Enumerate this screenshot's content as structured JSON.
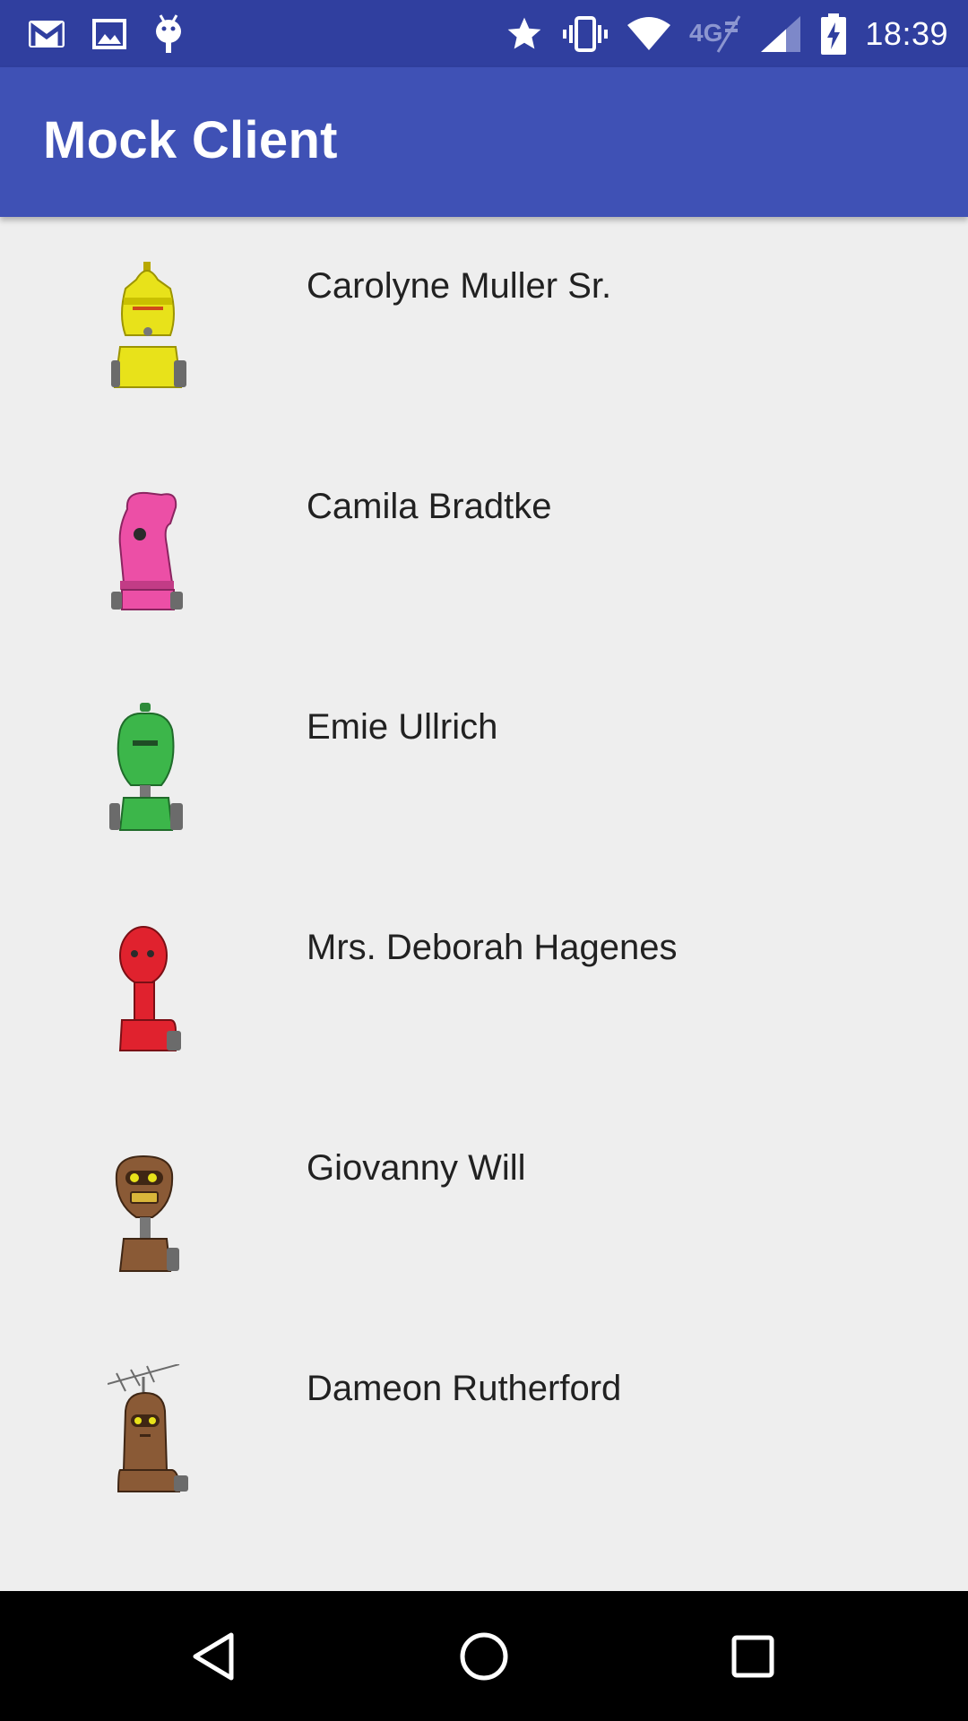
{
  "status_bar": {
    "time": "18:39",
    "left_icons": [
      "gmail-icon",
      "gallery-icon",
      "android-debug-icon"
    ],
    "right_icons": [
      "star-icon",
      "vibrate-icon",
      "wifi-icon",
      "4g-lte-icon",
      "signal-icon",
      "battery-charging-icon"
    ],
    "network_label": "4G"
  },
  "app_bar": {
    "title": "Mock Client",
    "color": "#3f51b5"
  },
  "contacts": [
    {
      "name": "Carolyne Muller Sr.",
      "avatar": "robot-avatar-yellow-icon",
      "color": "#e6e01a"
    },
    {
      "name": "Camila Bradtke",
      "avatar": "robot-avatar-pink-icon",
      "color": "#ec4fa6"
    },
    {
      "name": "Emie Ullrich",
      "avatar": "robot-avatar-green-icon",
      "color": "#3cb64a"
    },
    {
      "name": "Mrs. Deborah Hagenes",
      "avatar": "robot-avatar-red-icon",
      "color": "#e0222e"
    },
    {
      "name": "Giovanny Will",
      "avatar": "robot-avatar-brown-icon",
      "color": "#8a5a36"
    },
    {
      "name": "Dameon Rutherford",
      "avatar": "robot-avatar-antenna-icon",
      "color": "#8a5a36"
    }
  ],
  "nav_bar": {
    "buttons": [
      "back-icon",
      "home-icon",
      "recents-icon"
    ]
  }
}
